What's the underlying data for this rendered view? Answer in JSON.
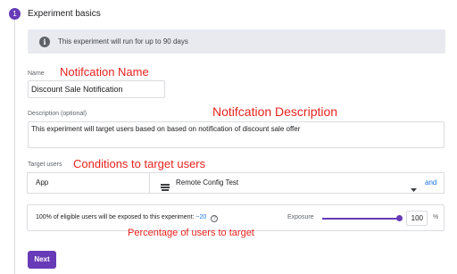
{
  "step": {
    "number": "1",
    "title": "Experiment basics"
  },
  "info": {
    "icon": "info-icon",
    "glyph": "i",
    "text": "This experiment will run for up to 90 days"
  },
  "name": {
    "label": "Name",
    "value": "Discount Sale Notification"
  },
  "description": {
    "label": "Description (optional)",
    "value": "This experiment will target users based on based on notification of discount sale offer"
  },
  "targeting": {
    "label": "Target users",
    "app": "App",
    "config_icon": "remote-config-icon",
    "config": "Remote Config Test",
    "dropdown_icon": "caret-down-icon",
    "and_label": "and"
  },
  "exposure": {
    "text_prefix": "100% of eligible users will be exposed to this experiment:",
    "approx": "~20",
    "help_glyph": "?",
    "label": "Exposure",
    "level": 1.0,
    "value": "100",
    "unit": "%"
  },
  "next_button": {
    "label": "Next"
  },
  "annotations": {
    "name": "Notifcation Name",
    "description": "Notifcation Description",
    "conditions": "Conditions to target users",
    "percentage": "Percentage of users to target"
  },
  "colors": {
    "accent": "#673ab7",
    "annotation": "#e8231e",
    "link": "#1a73e8",
    "banner": "#e8eaf0"
  }
}
